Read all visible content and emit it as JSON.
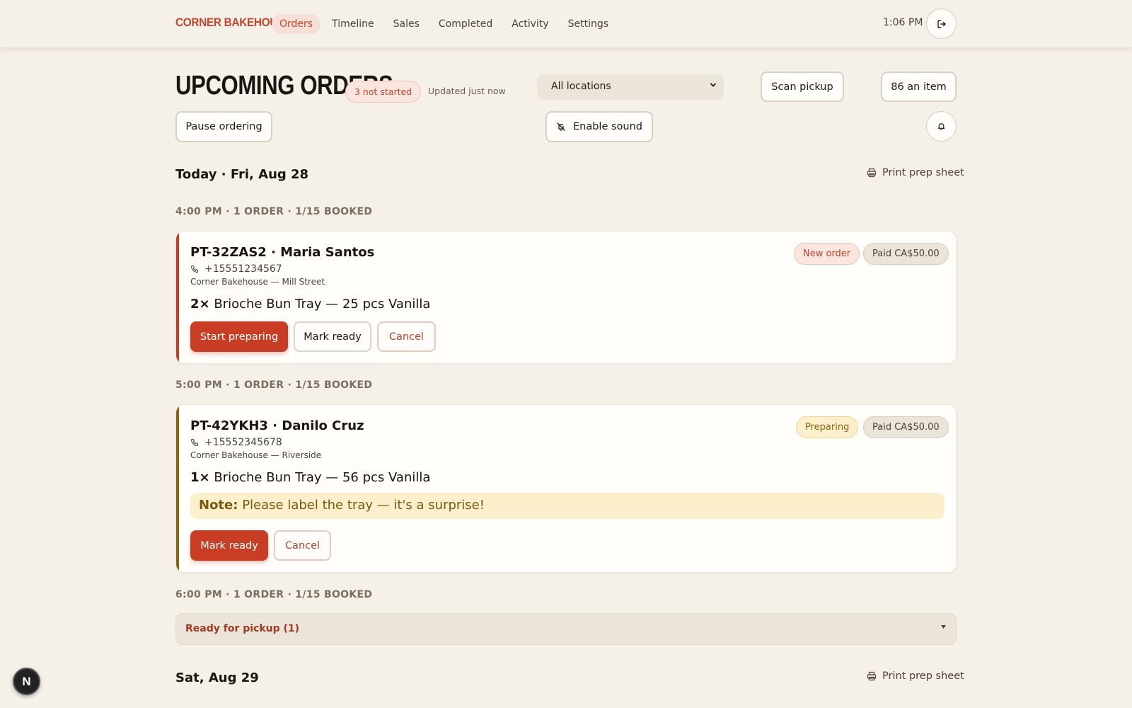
{
  "app": {
    "brand": "CORNER BAKEHOUSE",
    "clock": "1:06 PM"
  },
  "nav": {
    "items": [
      {
        "label": "Orders",
        "active": true
      },
      {
        "label": "Timeline"
      },
      {
        "label": "Sales"
      },
      {
        "label": "Completed"
      },
      {
        "label": "Activity"
      },
      {
        "label": "Settings"
      }
    ]
  },
  "header": {
    "title": "UPCOMING ORDERS",
    "not_started_badge": "3 not started",
    "updated": "Updated just now",
    "location_select": "All locations",
    "scan_pickup": "Scan pickup",
    "eighty_six": "86 an item",
    "pause_ordering": "Pause ordering",
    "enable_sound": "Enable sound"
  },
  "days": [
    {
      "title": "Today · Fri, Aug 28",
      "print_label": "Print prep sheet",
      "slots": [
        {
          "heading": "4:00 PM · 1 ORDER · 1/15 BOOKED",
          "order": {
            "title": "PT-32ZAS2 · Maria Santos",
            "phone": "+15551234567",
            "location": "Corner Bakehouse — Mill Street",
            "qty": "2×",
            "item": "Brioche Bun Tray — 25 pcs Vanilla",
            "status": "New order",
            "paid": "Paid CA$50.00",
            "actions": [
              "Start preparing",
              "Mark ready",
              "Cancel"
            ]
          }
        },
        {
          "heading": "5:00 PM · 1 ORDER · 1/15 BOOKED",
          "order": {
            "title": "PT-42YKH3 · Danilo Cruz",
            "phone": "+15552345678",
            "location": "Corner Bakehouse — Riverside",
            "qty": "1×",
            "item": "Brioche Bun Tray — 56 pcs Vanilla",
            "note_label": "Note:",
            "note": "Please label the tray — it's a surprise!",
            "status": "Preparing",
            "paid": "Paid CA$50.00",
            "actions": [
              "Mark ready",
              "Cancel"
            ]
          }
        },
        {
          "heading": "6:00 PM · 1 ORDER · 1/15 BOOKED",
          "collapsed": "Ready for pickup (1)"
        }
      ]
    },
    {
      "title": "Sat, Aug 29",
      "print_label": "Print prep sheet"
    }
  ],
  "colors": {
    "brand": "#c4452b",
    "background": "#f5f0e8",
    "new_order_accent": "#c93d24",
    "preparing_accent": "#8a6410"
  },
  "icons": [
    "logout-icon",
    "bell-icon",
    "sound-off-icon",
    "printer-icon",
    "phone-icon",
    "chevron-down-icon",
    "caret-down-icon"
  ],
  "dev_badge": "N"
}
